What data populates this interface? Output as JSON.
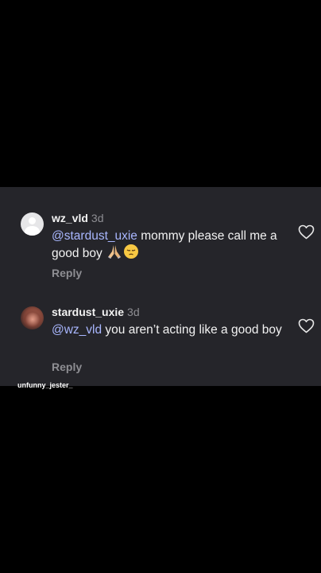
{
  "comments": [
    {
      "username": "wz_vld",
      "time": "3d",
      "mention": "@stardust_uxie",
      "text": " mommy please call me a good boy ",
      "emojis": "praying-hands-emoji, pensive-face-emoji",
      "reply_label": "Reply",
      "avatar": "default-avatar-icon"
    },
    {
      "username": "stardust_uxie",
      "time": "3d",
      "mention": "@wz_vld",
      "text": " you aren’t acting like a good boy",
      "reply_label": "Reply",
      "avatar": "profile-photo"
    }
  ],
  "watermark": "unfunny_jester_",
  "colors": {
    "page_background": "#000000",
    "panel_background": "#25252a",
    "text": "#f2f2f2",
    "secondary_text": "#8e8e93",
    "mention": "#a9b7ff"
  },
  "icons": {
    "like": "heart-outline-icon"
  }
}
